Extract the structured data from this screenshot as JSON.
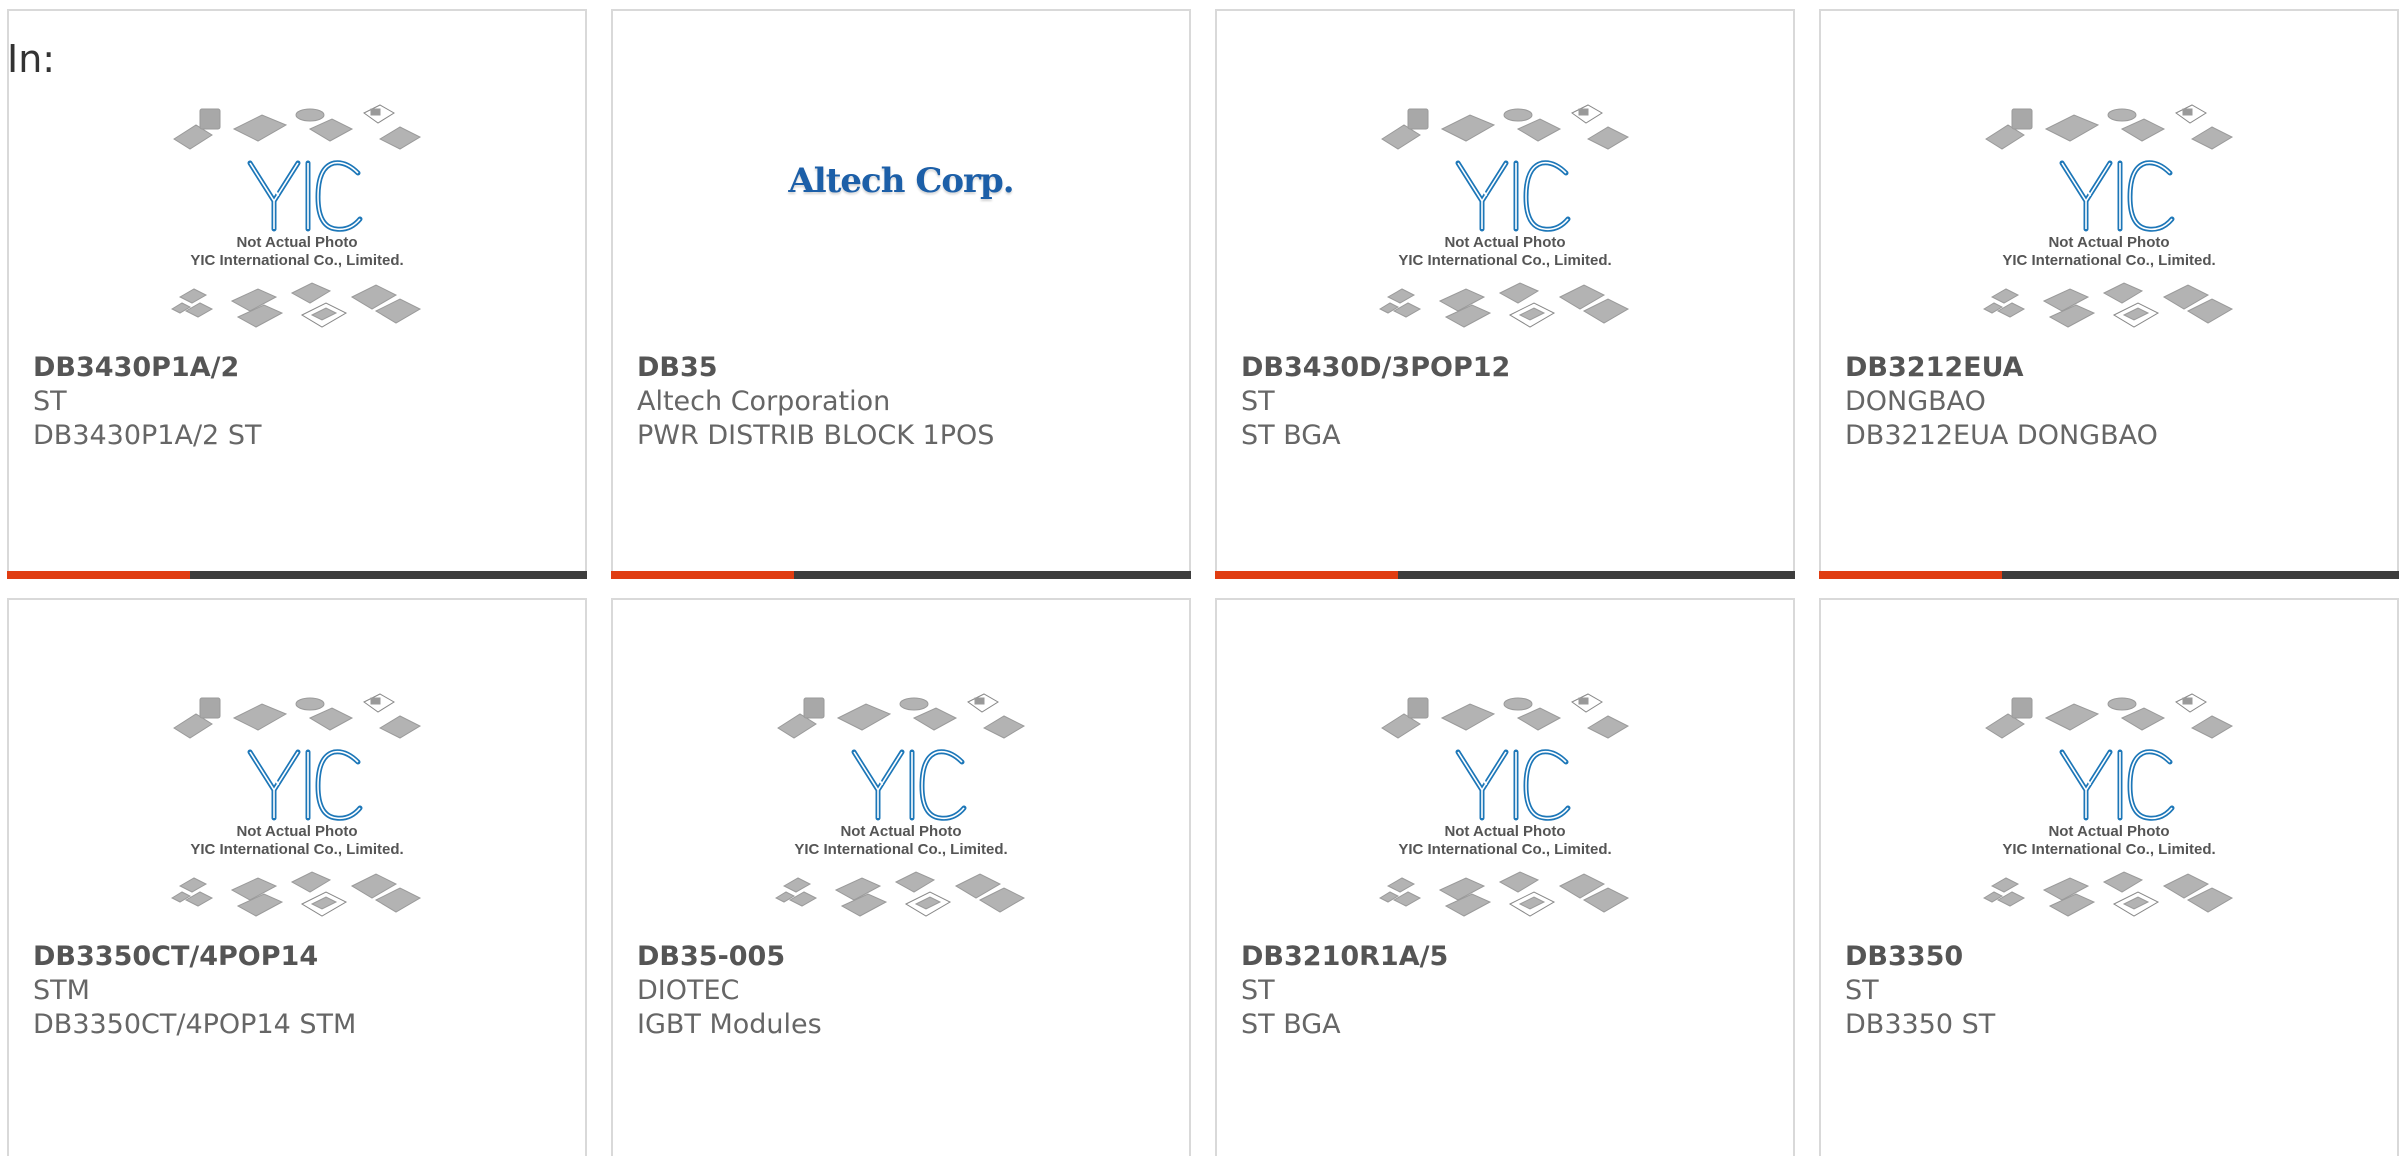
{
  "header": {
    "in_label": "In:"
  },
  "colors": {
    "accent": "#e03d12",
    "bar_dark": "#3d3d3d",
    "yic_blue": "#1d77b8",
    "card_border": "#d9d9d9"
  },
  "placeholder_image": {
    "icon": "yic-placeholder-icon",
    "line1": "Not Actual Photo",
    "line2": "YIC International Co., Limited.",
    "logo_text": "YIC"
  },
  "products": [
    {
      "part_number": "DB3430P1A/2",
      "manufacturer": "ST",
      "description": "DB3430P1A/2 ST",
      "image": "placeholder"
    },
    {
      "part_number": "DB35",
      "manufacturer": "Altech Corporation",
      "description": "PWR DISTRIB BLOCK 1POS",
      "image": "altech",
      "logo_text": "Altech Corp."
    },
    {
      "part_number": "DB3430D/3POP12",
      "manufacturer": "ST",
      "description": "ST BGA",
      "image": "placeholder"
    },
    {
      "part_number": "DB3212EUA",
      "manufacturer": "DONGBAO",
      "description": "DB3212EUA DONGBAO",
      "image": "placeholder"
    },
    {
      "part_number": "DB3350CT/4POP14",
      "manufacturer": "STM",
      "description": "DB3350CT/4POP14 STM",
      "image": "placeholder"
    },
    {
      "part_number": "DB35-005",
      "manufacturer": "DIOTEC",
      "description": "IGBT Modules",
      "image": "placeholder"
    },
    {
      "part_number": "DB3210R1A/5",
      "manufacturer": "ST",
      "description": "ST BGA",
      "image": "placeholder"
    },
    {
      "part_number": "DB3350",
      "manufacturer": "ST",
      "description": "DB3350 ST",
      "image": "placeholder"
    }
  ]
}
